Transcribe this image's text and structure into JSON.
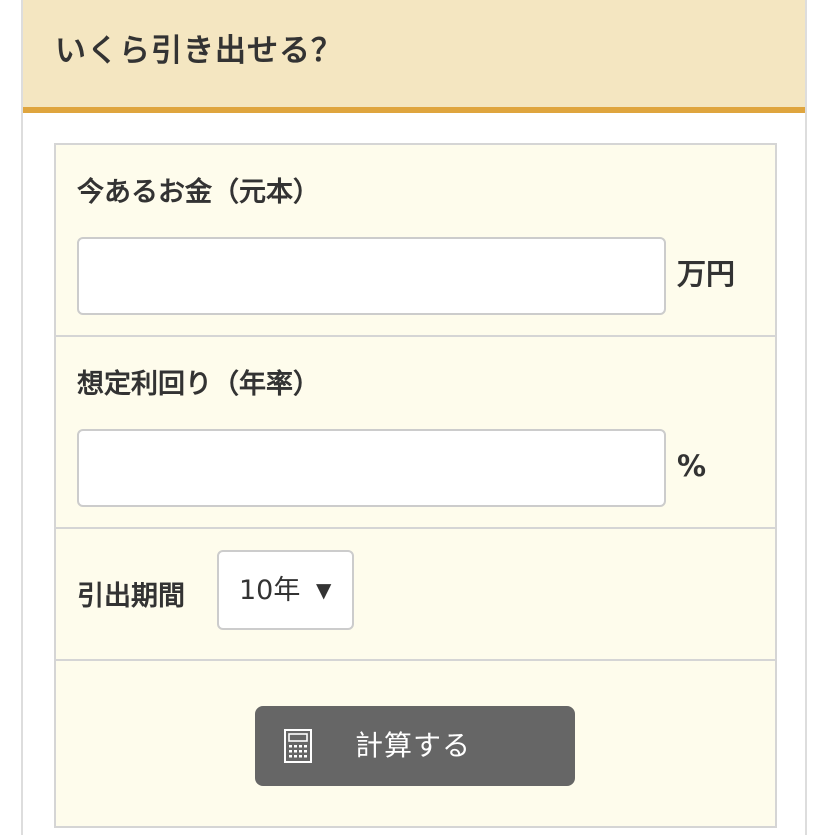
{
  "header": {
    "title": "いくら引き出せる？"
  },
  "form": {
    "principal": {
      "label": "今あるお金（元本）",
      "value": "",
      "placeholder": "",
      "unit": "万円"
    },
    "rate": {
      "label": "想定利回り（年率）",
      "value": "",
      "placeholder": "",
      "unit": "%"
    },
    "period": {
      "label": "引出期間",
      "selected": "10年",
      "arrow": "▼"
    },
    "submit": {
      "label": "計算する",
      "icon": "calculator-icon"
    }
  },
  "colors": {
    "header_bg": "#f4e6c1",
    "header_accent": "#dfa53e",
    "form_bg": "#fefcec",
    "button_bg": "#666666"
  }
}
